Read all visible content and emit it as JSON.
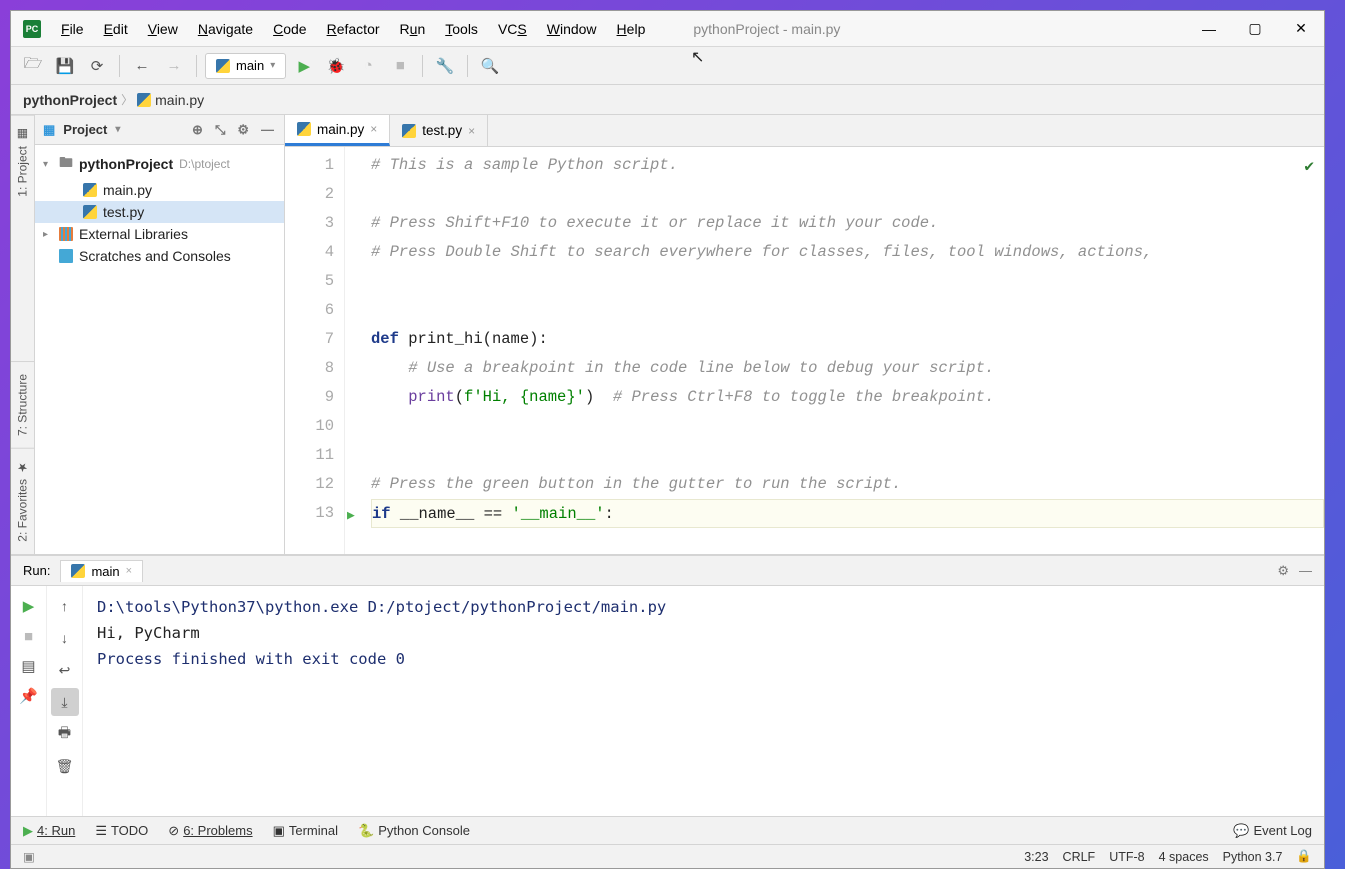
{
  "window_title": "pythonProject - main.py",
  "menu": [
    "File",
    "Edit",
    "View",
    "Navigate",
    "Code",
    "Refactor",
    "Run",
    "Tools",
    "VCS",
    "Window",
    "Help"
  ],
  "run_config": "main",
  "breadcrumb": {
    "project": "pythonProject",
    "file": "main.py"
  },
  "project_panel": {
    "title": "Project",
    "root": "pythonProject",
    "root_path": "D:\\ptoject",
    "files": [
      "main.py",
      "test.py"
    ],
    "external": "External Libraries",
    "scratches": "Scratches and Consoles"
  },
  "tabs": [
    {
      "name": "main.py",
      "active": true
    },
    {
      "name": "test.py",
      "active": false
    }
  ],
  "code_lines": [
    {
      "n": 1,
      "segs": [
        {
          "c": "c-comment",
          "t": "# This is a sample Python script."
        }
      ]
    },
    {
      "n": 2,
      "segs": []
    },
    {
      "n": 3,
      "segs": [
        {
          "c": "c-comment",
          "t": "# Press Shift+F10 to execute it or replace it with your code."
        }
      ]
    },
    {
      "n": 4,
      "segs": [
        {
          "c": "c-comment",
          "t": "# Press Double Shift to search everywhere for classes, files, tool windows, actions,"
        }
      ]
    },
    {
      "n": 5,
      "segs": []
    },
    {
      "n": 6,
      "segs": []
    },
    {
      "n": 7,
      "segs": [
        {
          "c": "c-key",
          "t": "def "
        },
        {
          "c": "c-func",
          "t": "print_hi"
        },
        {
          "c": "c-par",
          "t": "(name):"
        }
      ]
    },
    {
      "n": 8,
      "segs": [
        {
          "c": "",
          "t": "    "
        },
        {
          "c": "c-comment",
          "t": "# Use a breakpoint in the code line below to debug your script."
        }
      ]
    },
    {
      "n": 9,
      "segs": [
        {
          "c": "",
          "t": "    "
        },
        {
          "c": "c-builtin",
          "t": "print"
        },
        {
          "c": "c-par",
          "t": "("
        },
        {
          "c": "c-str",
          "t": "f'Hi, {name}'"
        },
        {
          "c": "c-par",
          "t": ")"
        },
        {
          "c": "",
          "t": "  "
        },
        {
          "c": "c-comment",
          "t": "# Press Ctrl+F8 to toggle the breakpoint."
        }
      ]
    },
    {
      "n": 10,
      "segs": []
    },
    {
      "n": 11,
      "segs": []
    },
    {
      "n": 12,
      "segs": [
        {
          "c": "c-comment",
          "t": "# Press the green button in the gutter to run the script."
        }
      ]
    },
    {
      "n": 13,
      "segs": [
        {
          "c": "c-key",
          "t": "if "
        },
        {
          "c": "c-par",
          "t": "__name__ == "
        },
        {
          "c": "c-str",
          "t": "'__main__'"
        },
        {
          "c": "c-par",
          "t": ":"
        }
      ],
      "current": true
    }
  ],
  "run_panel": {
    "label": "Run:",
    "tab": "main",
    "lines": [
      "D:\\tools\\Python37\\python.exe D:/ptoject/pythonProject/main.py",
      "Hi, PyCharm",
      "",
      "Process finished with exit code 0"
    ]
  },
  "bottom_tools": {
    "run": "4: Run",
    "todo": "TODO",
    "problems": "6: Problems",
    "terminal": "Terminal",
    "python_console": "Python Console",
    "event_log": "Event Log"
  },
  "status": {
    "pos": "3:23",
    "line_sep": "CRLF",
    "encoding": "UTF-8",
    "indent": "4 spaces",
    "interpreter": "Python 3.7"
  },
  "side_tabs": {
    "project": "1: Project",
    "structure": "7: Structure",
    "favorites": "2: Favorites"
  }
}
